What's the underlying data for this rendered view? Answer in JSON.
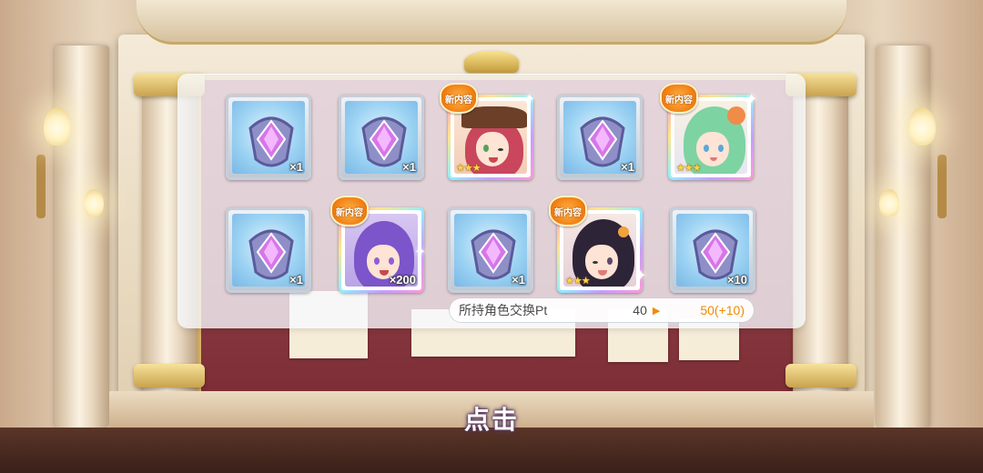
{
  "panel": {
    "slots": [
      {
        "kind": "item",
        "count": "×1"
      },
      {
        "kind": "item",
        "count": "×1"
      },
      {
        "kind": "character",
        "badge": "新内容",
        "stars": "★★★",
        "hair": "#c9465d",
        "hat": "#6c3f28",
        "eyes": "#59a05a"
      },
      {
        "kind": "item",
        "count": "×1"
      },
      {
        "kind": "character",
        "badge": "新内容",
        "stars": "★★★",
        "hair": "#7ed3a3",
        "hat": "#f08c4a",
        "eyes": "#5ea7d8"
      },
      {
        "kind": "item",
        "count": "×1"
      },
      {
        "kind": "character-item",
        "badge": "新内容",
        "count": "×200",
        "hair": "#7b55c9",
        "eyes": "#8e5fd6"
      },
      {
        "kind": "item",
        "count": "×1"
      },
      {
        "kind": "character",
        "badge": "新内容",
        "stars": "★★★",
        "hair": "#2e2438",
        "hat": "#f1a23c",
        "eyes": "#5b4a6a"
      },
      {
        "kind": "item",
        "count": "×10"
      }
    ],
    "pt": {
      "label": "所持角色交换Pt",
      "current": "40",
      "after": "50(+10)"
    }
  },
  "prompt": {
    "tap_label": "点击"
  },
  "colors": {
    "accent_orange": "#f08c00",
    "panel_bg": "#f7faff"
  }
}
